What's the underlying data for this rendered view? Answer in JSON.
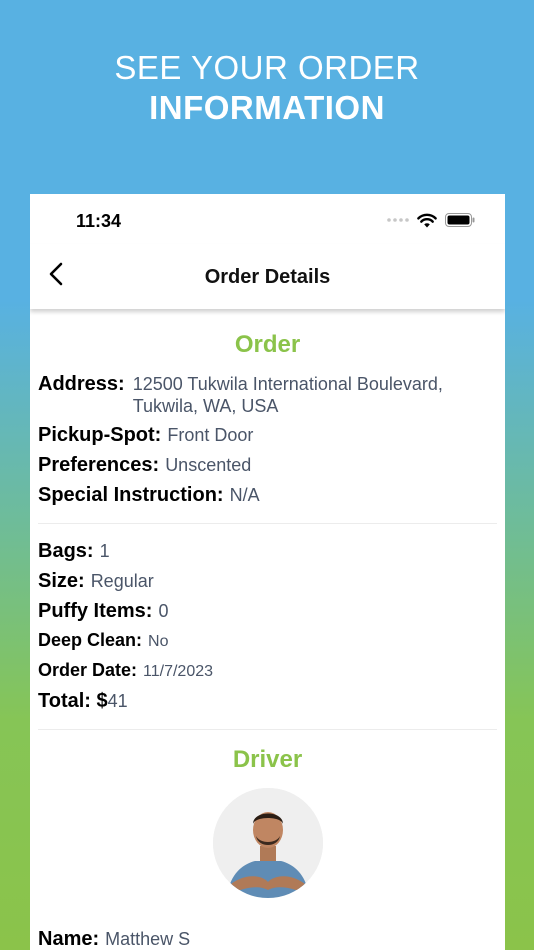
{
  "hero": {
    "line1": "SEE YOUR ORDER",
    "line2": "INFORMATION"
  },
  "status_bar": {
    "time": "11:34",
    "icons": [
      "signal-dots-icon",
      "wifi-icon",
      "battery-icon"
    ]
  },
  "nav": {
    "title": "Order Details",
    "back_icon": "chevron-left-icon"
  },
  "order": {
    "section_title": "Order",
    "address_label": "Address:",
    "address_value": "12500 Tukwila International Boulevard, Tukwila, WA, USA",
    "pickup_label": "Pickup-Spot:",
    "pickup_value": "Front Door",
    "preferences_label": "Preferences:",
    "preferences_value": "Unscented",
    "instruction_label": "Special Instruction:",
    "instruction_value": "N/A",
    "bags_label": "Bags:",
    "bags_value": "1",
    "size_label": "Size:",
    "size_value": "Regular",
    "puffy_label": "Puffy Items:",
    "puffy_value": "0",
    "deep_clean_label": "Deep Clean:",
    "deep_clean_value": "No",
    "order_date_label": "Order Date:",
    "order_date_value": "11/7/2023",
    "total_label": "Total: $",
    "total_value": "41"
  },
  "driver": {
    "section_title": "Driver",
    "name_label": "Name:",
    "name_value": "Matthew S"
  },
  "colors": {
    "accent_green": "#8bc34a",
    "sky_blue": "#58b1e2",
    "value_gray": "#4a5568"
  }
}
